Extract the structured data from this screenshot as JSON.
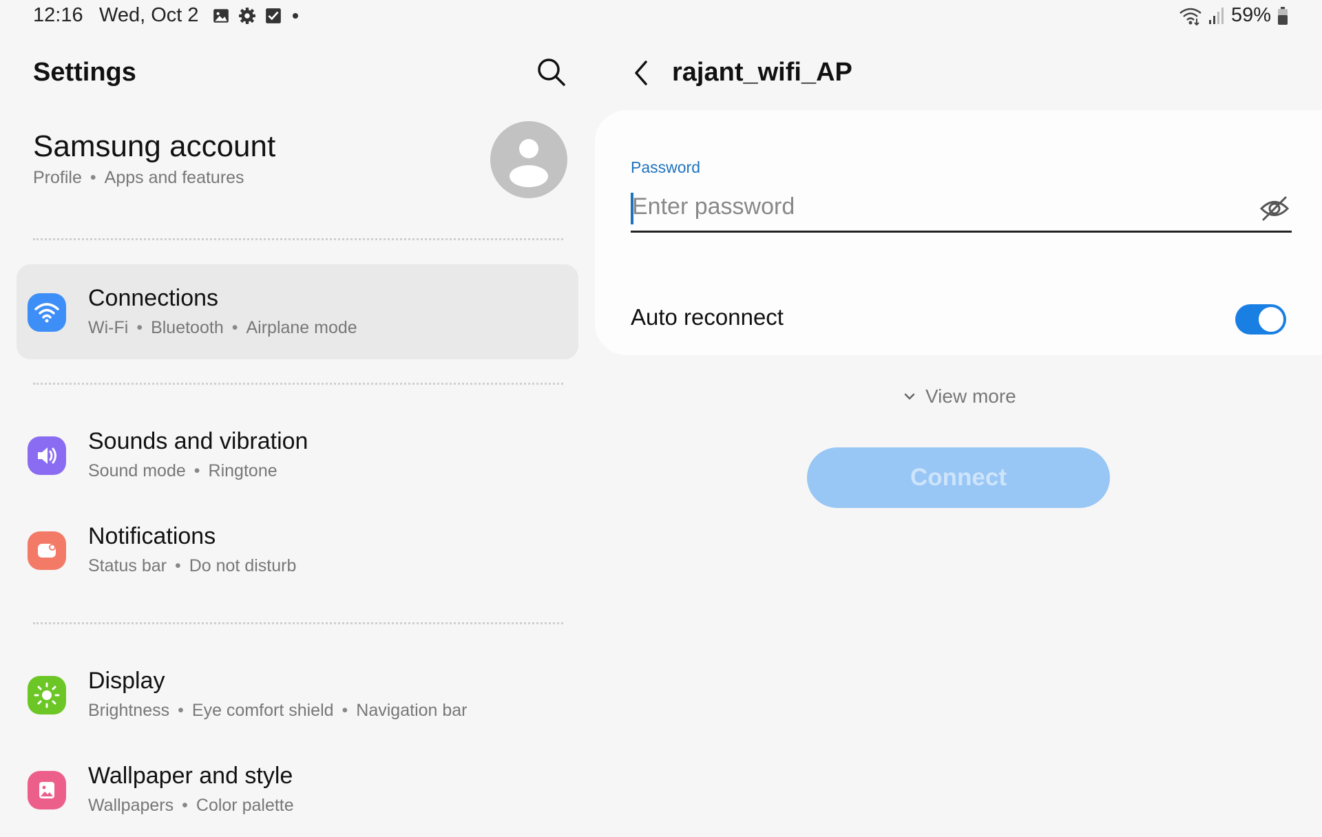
{
  "status_bar": {
    "time": "12:16",
    "date": "Wed, Oct 2",
    "battery": "59%",
    "icons": [
      "gallery-icon",
      "gear-icon",
      "checkbox-icon",
      "dot-icon",
      "wifi-icon",
      "signal-icon",
      "battery-icon"
    ]
  },
  "left": {
    "title": "Settings",
    "account": {
      "title": "Samsung account",
      "sub": [
        "Profile",
        "Apps and features"
      ]
    },
    "items": [
      {
        "title": "Connections",
        "sub": [
          "Wi-Fi",
          "Bluetooth",
          "Airplane mode"
        ],
        "icon": "wifi-icon",
        "color": "#3e8ef7"
      },
      {
        "title": "Sounds and vibration",
        "sub": [
          "Sound mode",
          "Ringtone"
        ],
        "icon": "speaker-icon",
        "color": "#8a6cf2"
      },
      {
        "title": "Notifications",
        "sub": [
          "Status bar",
          "Do not disturb"
        ],
        "icon": "notification-icon",
        "color": "#f27a66"
      },
      {
        "title": "Display",
        "sub": [
          "Brightness",
          "Eye comfort shield",
          "Navigation bar"
        ],
        "icon": "sun-icon",
        "color": "#6cc626"
      },
      {
        "title": "Wallpaper and style",
        "sub": [
          "Wallpapers",
          "Color palette"
        ],
        "icon": "wallpaper-icon",
        "color": "#ec5f8a"
      }
    ]
  },
  "right": {
    "network_title": "rajant_wifi_AP",
    "password_label": "Password",
    "password_placeholder": "Enter password",
    "password_value": "",
    "auto_reconnect_label": "Auto reconnect",
    "auto_reconnect_on": true,
    "view_more_label": "View more",
    "connect_label": "Connect"
  },
  "colors": {
    "accent": "#1a7fe3",
    "connect_disabled": "#98c6f5",
    "background": "#f6f6f6"
  }
}
